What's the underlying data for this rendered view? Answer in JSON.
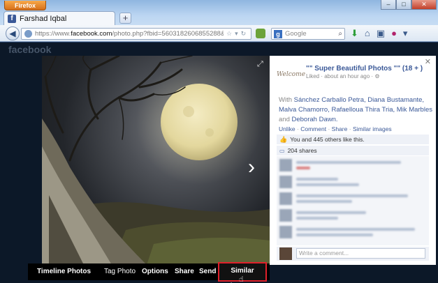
{
  "browser": {
    "app_button": "Firefox",
    "tab_title": "Farshad Iqbal",
    "new_tab": "+",
    "url_prefix": "https://www.",
    "url_domain": "facebook.com",
    "url_rest": "/photo.php?fbid=5603182606855288&set=a.42794989",
    "search_engine_icon": "google-icon",
    "search_placeholder": "Google",
    "window_controls": [
      "–",
      "□",
      "✕"
    ]
  },
  "facebook": {
    "logo_text": "facebook"
  },
  "photo_viewer": {
    "bar": {
      "album": "Timeline Photos",
      "tag_photo": "Tag Photo",
      "options": "Options",
      "share": "Share",
      "send": "Send",
      "similar_images": "Similar images"
    }
  },
  "panel": {
    "welcome_text": "Welcome",
    "title": "\"\" Super Beautiful Photos \"\" (18 + )",
    "meta": "Liked · about an hour ago ·",
    "with_prefix": "With",
    "with_people": "Sánchez Carballo Petra, Diana Bustamante, Malva Chamorro, Rafaelloua Thira Tria, Mik Marbles",
    "with_and": "and",
    "with_last": "Deborah Dawn.",
    "actions": {
      "unlike": "Unlike",
      "comment": "Comment",
      "share": "Share",
      "similar": "Similar images"
    },
    "likes_text": "You and 445 others like this.",
    "shares_text": "204 shares",
    "write_comment_placeholder": "Write a comment..."
  },
  "colors": {
    "facebook_blue": "#3b5998",
    "highlight_red": "#e0202a"
  }
}
